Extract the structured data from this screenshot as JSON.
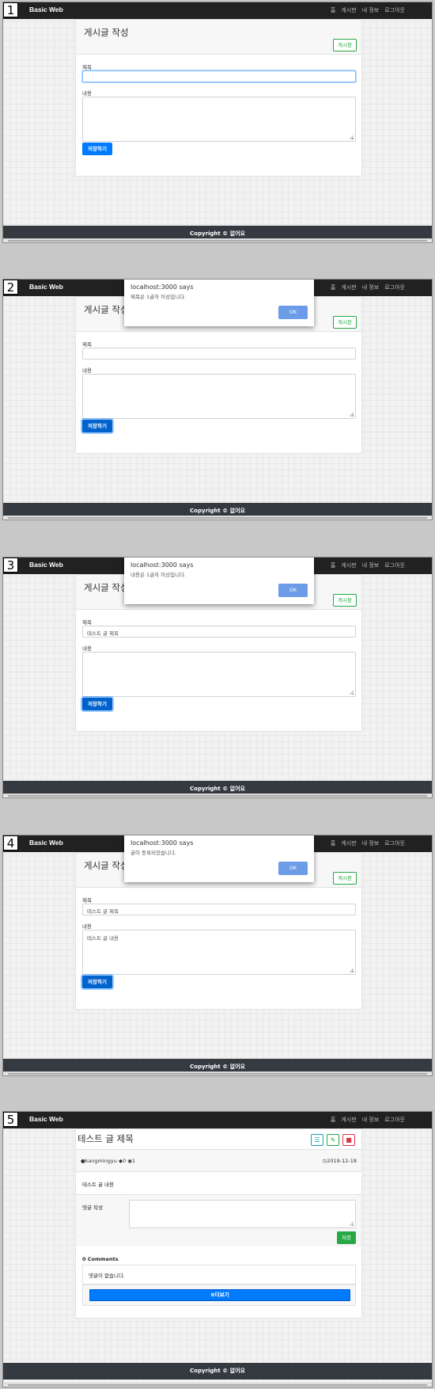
{
  "nav": {
    "brand": "Basic Web",
    "menu": [
      "홈",
      "게시판",
      "내 정보",
      "로그아웃"
    ]
  },
  "footer": "Copyright © 없어요",
  "write": {
    "page_title": "게시글 작성",
    "board_button": "게시판",
    "title_label": "제목",
    "content_label": "내용",
    "save_button": "저장하기"
  },
  "steps": [
    "1",
    "2",
    "3",
    "4",
    "5"
  ],
  "dialog": {
    "title": "localhost:3000 says",
    "ok": "OK",
    "messages": [
      "제목은 1글자 이상입니다.",
      "내용은 1글자 이상입니다.",
      "글이 등록되었습니다."
    ]
  },
  "inputs": {
    "title_value": "테스트 글 제목",
    "content_value": "테스트 글 내용"
  },
  "post": {
    "title": "테스트 글 제목",
    "author": "kangmingyu",
    "comment_count": "0",
    "views": "1",
    "date": "2019-12-18",
    "body": "테스트 글 내용",
    "comment_label": "댓글 작성",
    "comment_save": "저장",
    "comments_header": "0 Comments",
    "no_comments": "댓글이 없습니다.",
    "more_button": "더보기"
  }
}
